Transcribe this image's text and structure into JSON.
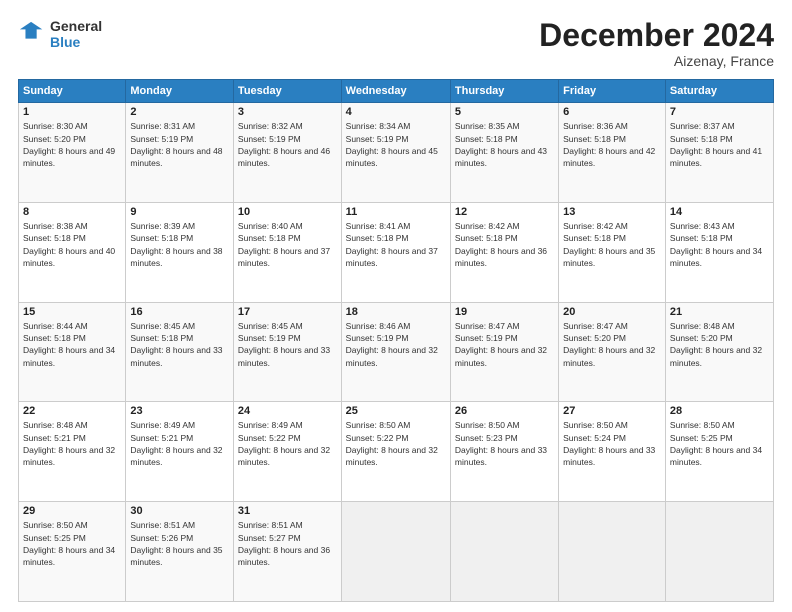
{
  "logo": {
    "line1": "General",
    "line2": "Blue"
  },
  "title": "December 2024",
  "location": "Aizenay, France",
  "days_header": [
    "Sunday",
    "Monday",
    "Tuesday",
    "Wednesday",
    "Thursday",
    "Friday",
    "Saturday"
  ],
  "weeks": [
    [
      {
        "day": "1",
        "sunrise": "8:30 AM",
        "sunset": "5:20 PM",
        "daylight": "8 hours and 49 minutes."
      },
      {
        "day": "2",
        "sunrise": "8:31 AM",
        "sunset": "5:19 PM",
        "daylight": "8 hours and 48 minutes."
      },
      {
        "day": "3",
        "sunrise": "8:32 AM",
        "sunset": "5:19 PM",
        "daylight": "8 hours and 46 minutes."
      },
      {
        "day": "4",
        "sunrise": "8:34 AM",
        "sunset": "5:19 PM",
        "daylight": "8 hours and 45 minutes."
      },
      {
        "day": "5",
        "sunrise": "8:35 AM",
        "sunset": "5:18 PM",
        "daylight": "8 hours and 43 minutes."
      },
      {
        "day": "6",
        "sunrise": "8:36 AM",
        "sunset": "5:18 PM",
        "daylight": "8 hours and 42 minutes."
      },
      {
        "day": "7",
        "sunrise": "8:37 AM",
        "sunset": "5:18 PM",
        "daylight": "8 hours and 41 minutes."
      }
    ],
    [
      {
        "day": "8",
        "sunrise": "8:38 AM",
        "sunset": "5:18 PM",
        "daylight": "8 hours and 40 minutes."
      },
      {
        "day": "9",
        "sunrise": "8:39 AM",
        "sunset": "5:18 PM",
        "daylight": "8 hours and 38 minutes."
      },
      {
        "day": "10",
        "sunrise": "8:40 AM",
        "sunset": "5:18 PM",
        "daylight": "8 hours and 37 minutes."
      },
      {
        "day": "11",
        "sunrise": "8:41 AM",
        "sunset": "5:18 PM",
        "daylight": "8 hours and 37 minutes."
      },
      {
        "day": "12",
        "sunrise": "8:42 AM",
        "sunset": "5:18 PM",
        "daylight": "8 hours and 36 minutes."
      },
      {
        "day": "13",
        "sunrise": "8:42 AM",
        "sunset": "5:18 PM",
        "daylight": "8 hours and 35 minutes."
      },
      {
        "day": "14",
        "sunrise": "8:43 AM",
        "sunset": "5:18 PM",
        "daylight": "8 hours and 34 minutes."
      }
    ],
    [
      {
        "day": "15",
        "sunrise": "8:44 AM",
        "sunset": "5:18 PM",
        "daylight": "8 hours and 34 minutes."
      },
      {
        "day": "16",
        "sunrise": "8:45 AM",
        "sunset": "5:18 PM",
        "daylight": "8 hours and 33 minutes."
      },
      {
        "day": "17",
        "sunrise": "8:45 AM",
        "sunset": "5:19 PM",
        "daylight": "8 hours and 33 minutes."
      },
      {
        "day": "18",
        "sunrise": "8:46 AM",
        "sunset": "5:19 PM",
        "daylight": "8 hours and 32 minutes."
      },
      {
        "day": "19",
        "sunrise": "8:47 AM",
        "sunset": "5:19 PM",
        "daylight": "8 hours and 32 minutes."
      },
      {
        "day": "20",
        "sunrise": "8:47 AM",
        "sunset": "5:20 PM",
        "daylight": "8 hours and 32 minutes."
      },
      {
        "day": "21",
        "sunrise": "8:48 AM",
        "sunset": "5:20 PM",
        "daylight": "8 hours and 32 minutes."
      }
    ],
    [
      {
        "day": "22",
        "sunrise": "8:48 AM",
        "sunset": "5:21 PM",
        "daylight": "8 hours and 32 minutes."
      },
      {
        "day": "23",
        "sunrise": "8:49 AM",
        "sunset": "5:21 PM",
        "daylight": "8 hours and 32 minutes."
      },
      {
        "day": "24",
        "sunrise": "8:49 AM",
        "sunset": "5:22 PM",
        "daylight": "8 hours and 32 minutes."
      },
      {
        "day": "25",
        "sunrise": "8:50 AM",
        "sunset": "5:22 PM",
        "daylight": "8 hours and 32 minutes."
      },
      {
        "day": "26",
        "sunrise": "8:50 AM",
        "sunset": "5:23 PM",
        "daylight": "8 hours and 33 minutes."
      },
      {
        "day": "27",
        "sunrise": "8:50 AM",
        "sunset": "5:24 PM",
        "daylight": "8 hours and 33 minutes."
      },
      {
        "day": "28",
        "sunrise": "8:50 AM",
        "sunset": "5:25 PM",
        "daylight": "8 hours and 34 minutes."
      }
    ],
    [
      {
        "day": "29",
        "sunrise": "8:50 AM",
        "sunset": "5:25 PM",
        "daylight": "8 hours and 34 minutes."
      },
      {
        "day": "30",
        "sunrise": "8:51 AM",
        "sunset": "5:26 PM",
        "daylight": "8 hours and 35 minutes."
      },
      {
        "day": "31",
        "sunrise": "8:51 AM",
        "sunset": "5:27 PM",
        "daylight": "8 hours and 36 minutes."
      },
      null,
      null,
      null,
      null
    ]
  ]
}
